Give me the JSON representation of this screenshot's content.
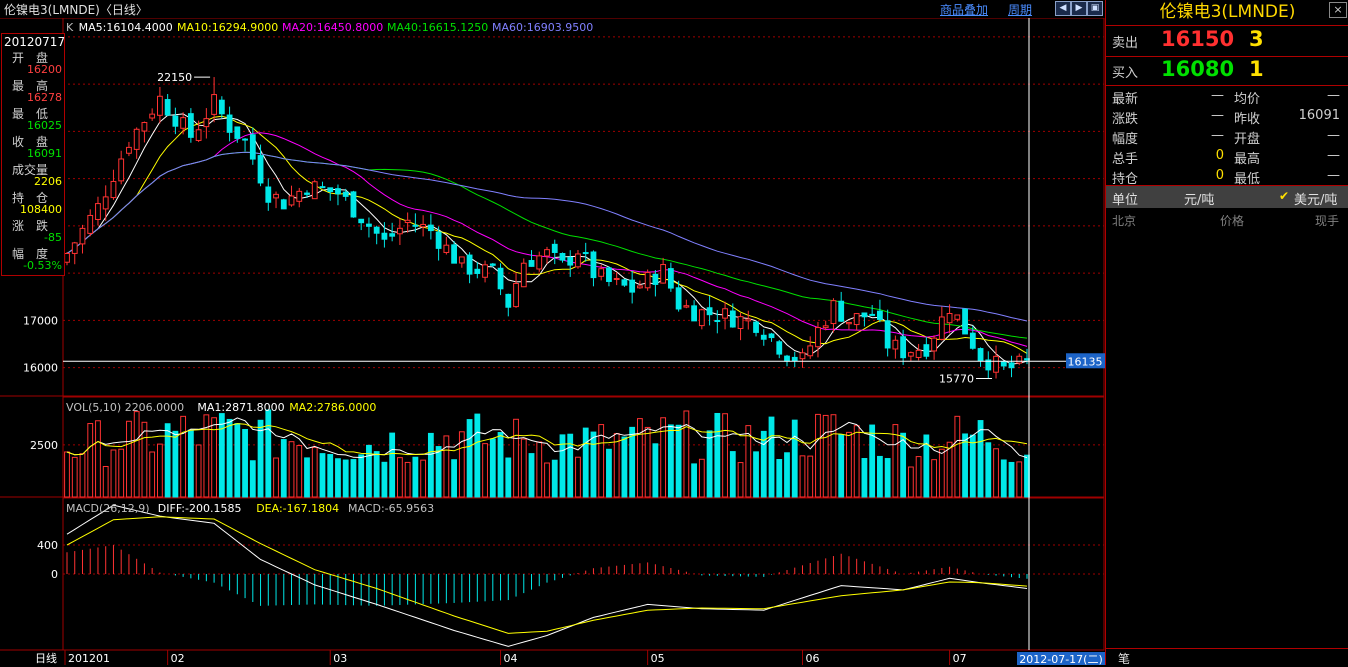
{
  "title": "伦镍电3(LMNDE)〈日线〉",
  "links": {
    "overlay": "商品叠加",
    "period": "周期"
  },
  "nav_icons": [
    "left-arrow-icon",
    "right-arrow-icon",
    "zoom-icon"
  ],
  "indicator_k": {
    "label": "K",
    "ma": [
      {
        "text": "MA5:16104.4000",
        "color": "#ffffff"
      },
      {
        "text": "MA10:16294.9000",
        "color": "#ffff00"
      },
      {
        "text": "MA20:16450.8000",
        "color": "#ff00ff"
      },
      {
        "text": "MA40:16615.1250",
        "color": "#00e000"
      },
      {
        "text": "MA60:16903.9500",
        "color": "#8080ff"
      }
    ]
  },
  "indicator_vol": {
    "parts": [
      {
        "text": "VOL(5,10) 2206.0000",
        "color": "#c0c0c0"
      },
      {
        "text": "MA1:2871.8000",
        "color": "#ffffff"
      },
      {
        "text": "MA2:2786.0000",
        "color": "#ffff00"
      }
    ]
  },
  "indicator_macd": {
    "parts": [
      {
        "text": "MACD(26,12,9)",
        "color": "#c0c0c0"
      },
      {
        "text": "DIFF:-200.1585",
        "color": "#ffffff"
      },
      {
        "text": "DEA:-167.1804",
        "color": "#ffff00"
      },
      {
        "text": "MACD:-65.9563",
        "color": "#c0c0c0"
      }
    ]
  },
  "left_info": {
    "date": "20120717",
    "items": [
      {
        "label": "开　盘",
        "value": "16200",
        "color": "#ff4040"
      },
      {
        "label": "最　高",
        "value": "16278",
        "color": "#ff4040"
      },
      {
        "label": "最　低",
        "value": "16025",
        "color": "#00e000"
      },
      {
        "label": "收　盘",
        "value": "16091",
        "color": "#00e000"
      },
      {
        "label": "成交量",
        "value": "2206",
        "color": "#ffff00"
      },
      {
        "label": "持　仓",
        "value": "108400",
        "color": "#ffff00"
      },
      {
        "label": "涨　跌",
        "value": "-85",
        "color": "#00e000"
      },
      {
        "label": "幅　度",
        "value": "-0.53%",
        "color": "#00e000"
      }
    ]
  },
  "right_panel": {
    "title": "伦镍电3(LMNDE)",
    "close": "×",
    "sell": {
      "label": "卖出",
      "price": "16150",
      "qty": "3"
    },
    "buy": {
      "label": "买入",
      "price": "16080",
      "qty": "1"
    },
    "rows": [
      {
        "l1": "最新",
        "v1": "—",
        "l2": "均价",
        "v2": "—"
      },
      {
        "l1": "涨跌",
        "v1": "—",
        "l2": "昨收",
        "v2": "16091"
      },
      {
        "l1": "幅度",
        "v1": "—",
        "l2": "开盘",
        "v2": "—"
      },
      {
        "l1": "总手",
        "v1": "0",
        "l2": "最高",
        "v2": "—"
      },
      {
        "l1": "持仓",
        "v1": "0",
        "l2": "最低",
        "v2": "—"
      }
    ],
    "unit_label": "单位",
    "unit_a": "元/吨",
    "unit_b": "美元/吨",
    "tick_headers": [
      "北京",
      "价格",
      "现手"
    ],
    "bottom_tab": "笔"
  },
  "colors": {
    "up": "#ff3232",
    "down": "#00e8e8",
    "grid": "#a00000",
    "price_line": "#ffffff"
  },
  "chart_data": {
    "type": "candlestick",
    "title": "伦镍电3(LMNDE)〈日线〉",
    "xlabel": "日线",
    "price_ticks": [
      "17000",
      "16000"
    ],
    "volume_ticks": [
      "2500"
    ],
    "macd_ticks": [
      "400",
      "0"
    ],
    "month_labels": [
      {
        "text": "201201",
        "index": 0
      },
      {
        "text": "02",
        "index": 13
      },
      {
        "text": "03",
        "index": 34
      },
      {
        "text": "04",
        "index": 56
      },
      {
        "text": "05",
        "index": 75
      },
      {
        "text": "06",
        "index": 95
      },
      {
        "text": "07",
        "index": 114
      }
    ],
    "annotations": {
      "high": "22150",
      "high_index": 19,
      "low": "15770",
      "low_index": 120,
      "last_price": "16135",
      "cursor_date": "2012-07-17(二)"
    },
    "ylim_price": [
      15400,
      23400
    ],
    "ylim_volume": [
      0,
      4600
    ],
    "ylim_macd": [
      -1050,
      1050
    ],
    "ohlc_close_anchors": [
      [
        0,
        18420
      ],
      [
        4,
        19400
      ],
      [
        8,
        20800
      ],
      [
        12,
        21700
      ],
      [
        16,
        20900
      ],
      [
        19,
        21600
      ],
      [
        21,
        21100
      ],
      [
        23,
        20800
      ],
      [
        26,
        19700
      ],
      [
        28,
        19500
      ],
      [
        31,
        19850
      ],
      [
        35,
        19700
      ],
      [
        38,
        19200
      ],
      [
        41,
        18650
      ],
      [
        44,
        19100
      ],
      [
        47,
        18900
      ],
      [
        51,
        18150
      ],
      [
        55,
        18000
      ],
      [
        57,
        17350
      ],
      [
        59,
        18250
      ],
      [
        62,
        18400
      ],
      [
        64,
        18150
      ],
      [
        66,
        18500
      ],
      [
        68,
        18000
      ],
      [
        70,
        17800
      ],
      [
        73,
        17650
      ],
      [
        77,
        18050
      ],
      [
        79,
        17350
      ],
      [
        81,
        17200
      ],
      [
        85,
        17100
      ],
      [
        89,
        16950
      ],
      [
        93,
        16300
      ],
      [
        95,
        16150
      ],
      [
        97,
        16800
      ],
      [
        99,
        17300
      ],
      [
        101,
        17000
      ],
      [
        104,
        17150
      ],
      [
        106,
        16500
      ],
      [
        108,
        16350
      ],
      [
        111,
        16450
      ],
      [
        114,
        17300
      ],
      [
        116,
        16800
      ],
      [
        118,
        16250
      ],
      [
        121,
        15950
      ],
      [
        124,
        16091
      ]
    ],
    "volume_anchors": [
      [
        0,
        2400
      ],
      [
        10,
        2900
      ],
      [
        19,
        3100
      ],
      [
        29,
        2800
      ],
      [
        39,
        2500
      ],
      [
        49,
        2900
      ],
      [
        59,
        2700
      ],
      [
        69,
        2600
      ],
      [
        79,
        2900
      ],
      [
        89,
        2700
      ],
      [
        99,
        3100
      ],
      [
        109,
        2600
      ],
      [
        119,
        3000
      ],
      [
        124,
        2206
      ]
    ],
    "macd_diff": [
      [
        0,
        550
      ],
      [
        6,
        950
      ],
      [
        12,
        800
      ],
      [
        19,
        700
      ],
      [
        25,
        200
      ],
      [
        32,
        -150
      ],
      [
        40,
        -420
      ],
      [
        50,
        -780
      ],
      [
        57,
        -1000
      ],
      [
        62,
        -850
      ],
      [
        68,
        -600
      ],
      [
        75,
        -420
      ],
      [
        82,
        -480
      ],
      [
        90,
        -500
      ],
      [
        100,
        -160
      ],
      [
        108,
        -220
      ],
      [
        114,
        -60
      ],
      [
        118,
        -120
      ],
      [
        124,
        -200
      ]
    ],
    "macd_dea": [
      [
        0,
        400
      ],
      [
        6,
        750
      ],
      [
        12,
        790
      ],
      [
        19,
        760
      ],
      [
        25,
        420
      ],
      [
        32,
        60
      ],
      [
        40,
        -200
      ],
      [
        50,
        -580
      ],
      [
        57,
        -820
      ],
      [
        62,
        -790
      ],
      [
        68,
        -640
      ],
      [
        75,
        -500
      ],
      [
        82,
        -470
      ],
      [
        90,
        -480
      ],
      [
        100,
        -300
      ],
      [
        108,
        -220
      ],
      [
        114,
        -110
      ],
      [
        118,
        -120
      ],
      [
        124,
        -167
      ]
    ]
  }
}
